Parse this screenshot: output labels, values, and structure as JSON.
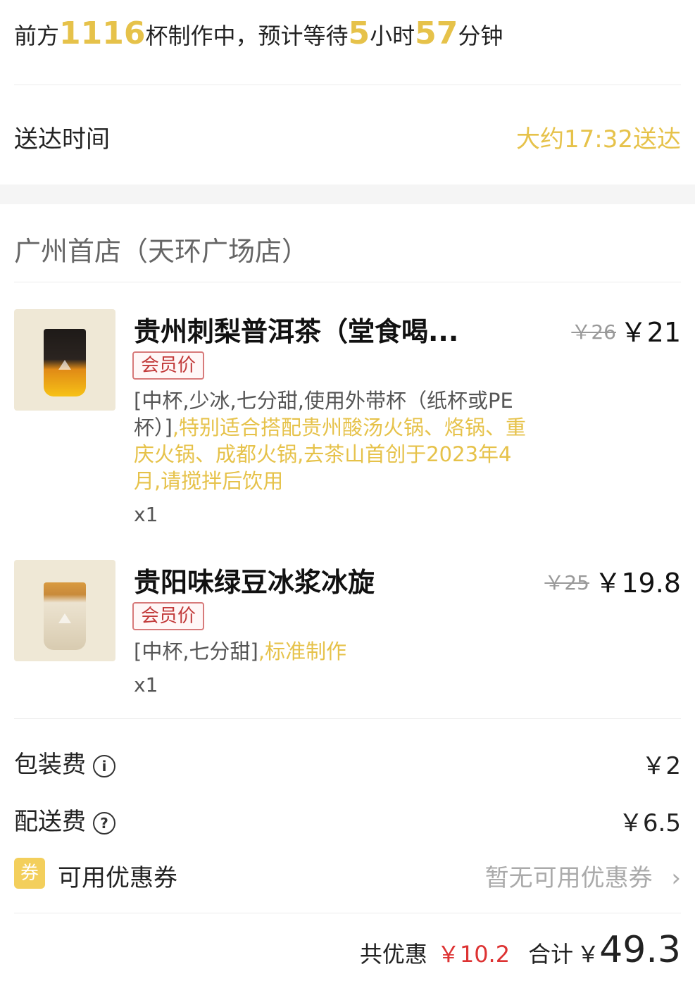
{
  "queue": {
    "prefix": "前方",
    "cups": "1116",
    "mid": "杯制作中，预计等待",
    "hours": "5",
    "hour_unit": "小时",
    "minutes": "57",
    "minute_unit": "分钟"
  },
  "delivery": {
    "label": "送达时间",
    "value": "大约17:32送达"
  },
  "store": {
    "name": "广州首店（天环广场店）"
  },
  "items": [
    {
      "name": "贵州刺梨普洱茶（堂食喝...",
      "original_price": "￥26",
      "price": "￥21",
      "tag": "会员价",
      "spec": "[中杯,少冰,七分甜,使用外带杯（纸杯或PE杯）]",
      "note": ",特别适合搭配贵州酸汤火锅、烙锅、重庆火锅、成都火锅,去茶山首创于2023年4月,请搅拌后饮用",
      "qty": "x1"
    },
    {
      "name": "贵阳味绿豆冰浆冰旋",
      "original_price": "￥25",
      "price": "￥19.8",
      "tag": "会员价",
      "spec": "[中杯,七分甜]",
      "note": ",标准制作",
      "qty": "x1"
    }
  ],
  "fees": {
    "packaging": {
      "label": "包装费",
      "icon": "i",
      "value": "￥2"
    },
    "delivery": {
      "label": "配送费",
      "icon": "?",
      "value": "￥6.5"
    }
  },
  "coupon": {
    "badge": "券",
    "label": "可用优惠券",
    "value": "暂无可用优惠券",
    "chevron": "›"
  },
  "total": {
    "discount_label": "共优惠",
    "discount": "￥10.2",
    "total_label": "合计",
    "currency": "￥",
    "amount": "49.3"
  },
  "colors": {
    "accent": "#e6c24a",
    "discount": "#d33333",
    "tag_border": "#d77a7a"
  }
}
